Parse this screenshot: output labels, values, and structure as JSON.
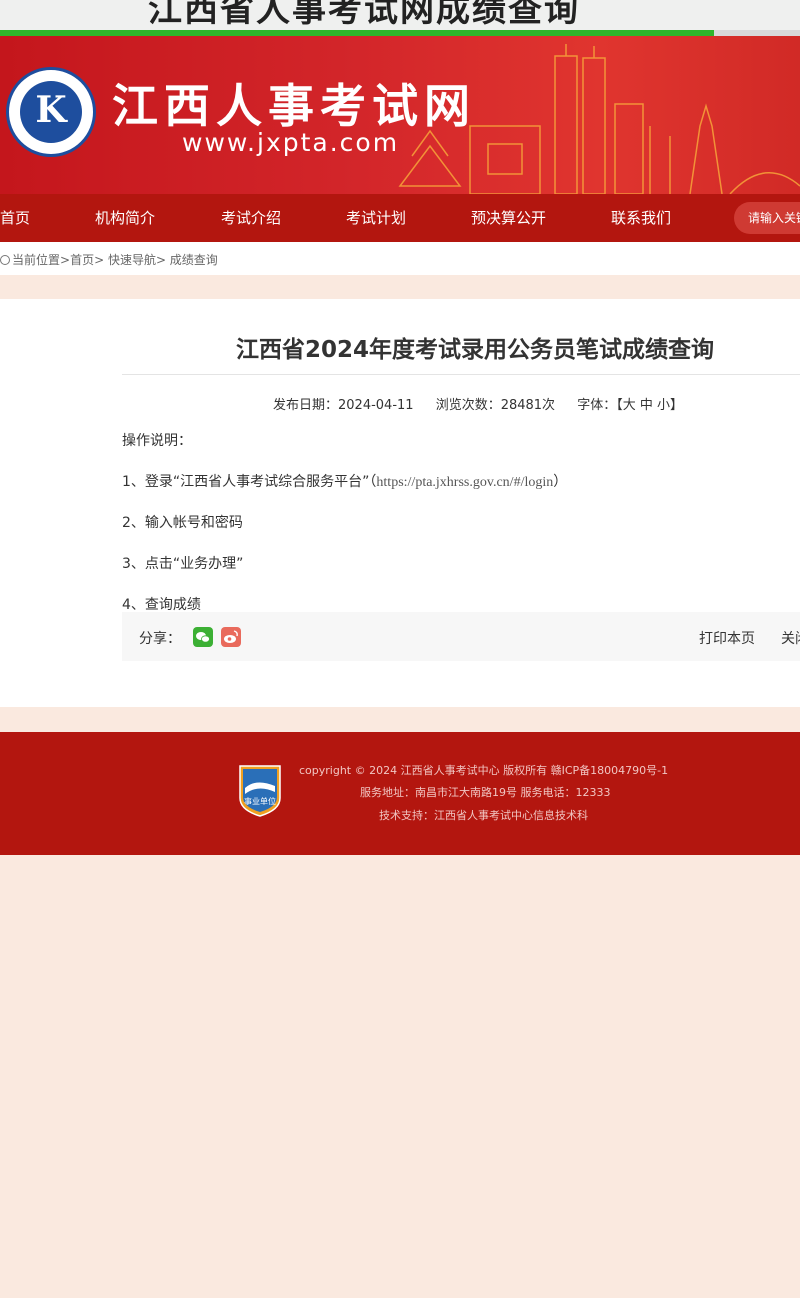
{
  "browser": {
    "title_fragment": "江西省人事考试网成绩查询"
  },
  "header": {
    "site_name": "江西人事考试网",
    "site_url": "www.jxpta.com",
    "logo_icon": "jiangxi-exam-center-logo-icon"
  },
  "nav": {
    "items": [
      "首页",
      "机构简介",
      "考试介绍",
      "考试计划",
      "预决算公开",
      "联系我们"
    ],
    "search_placeholder": "请输入关键"
  },
  "breadcrumb": {
    "icon": "location-icon",
    "label": "当前位置",
    "path": ">首页> 快速导航> 成绩查询"
  },
  "article": {
    "title": "江西省2024年度考试录用公务员笔试成绩查询",
    "publish_date": "发布日期：2024-04-11",
    "views": "浏览次数：28481次",
    "font_size_label": "字体：【大 中 小】",
    "instructions_heading": "操作说明：",
    "step1_text": "1、登录“江西省人事考试综合服务平台”（",
    "step1_url": "https://pta.jxhrss.gov.cn/#/login",
    "step1_end": "）",
    "step2": "2、输入帐号和密码",
    "step3": "3、点击“业务办理”",
    "step4": "4、查询成绩"
  },
  "share": {
    "label": "分享：",
    "icons": [
      "wechat-icon",
      "weibo-icon"
    ],
    "print": "打印本页",
    "close": "关闭"
  },
  "footer": {
    "badge_text": "事业单位",
    "copyright": "copyright © 2024 江西省人事考试中心 版权所有 赣ICP备18004790号-1",
    "address": "服务地址：南昌市江大南路19号 服务电话：12333",
    "support": "技术支持：江西省人事考试中心信息技术科"
  },
  "colors": {
    "brand_red": "#b3160f",
    "banner_red": "#d3262a",
    "page_bg": "#fae9df",
    "progress_green": "#2fb52b",
    "wechat_green": "#3cb034",
    "weibo_red": "#e96a5c"
  }
}
